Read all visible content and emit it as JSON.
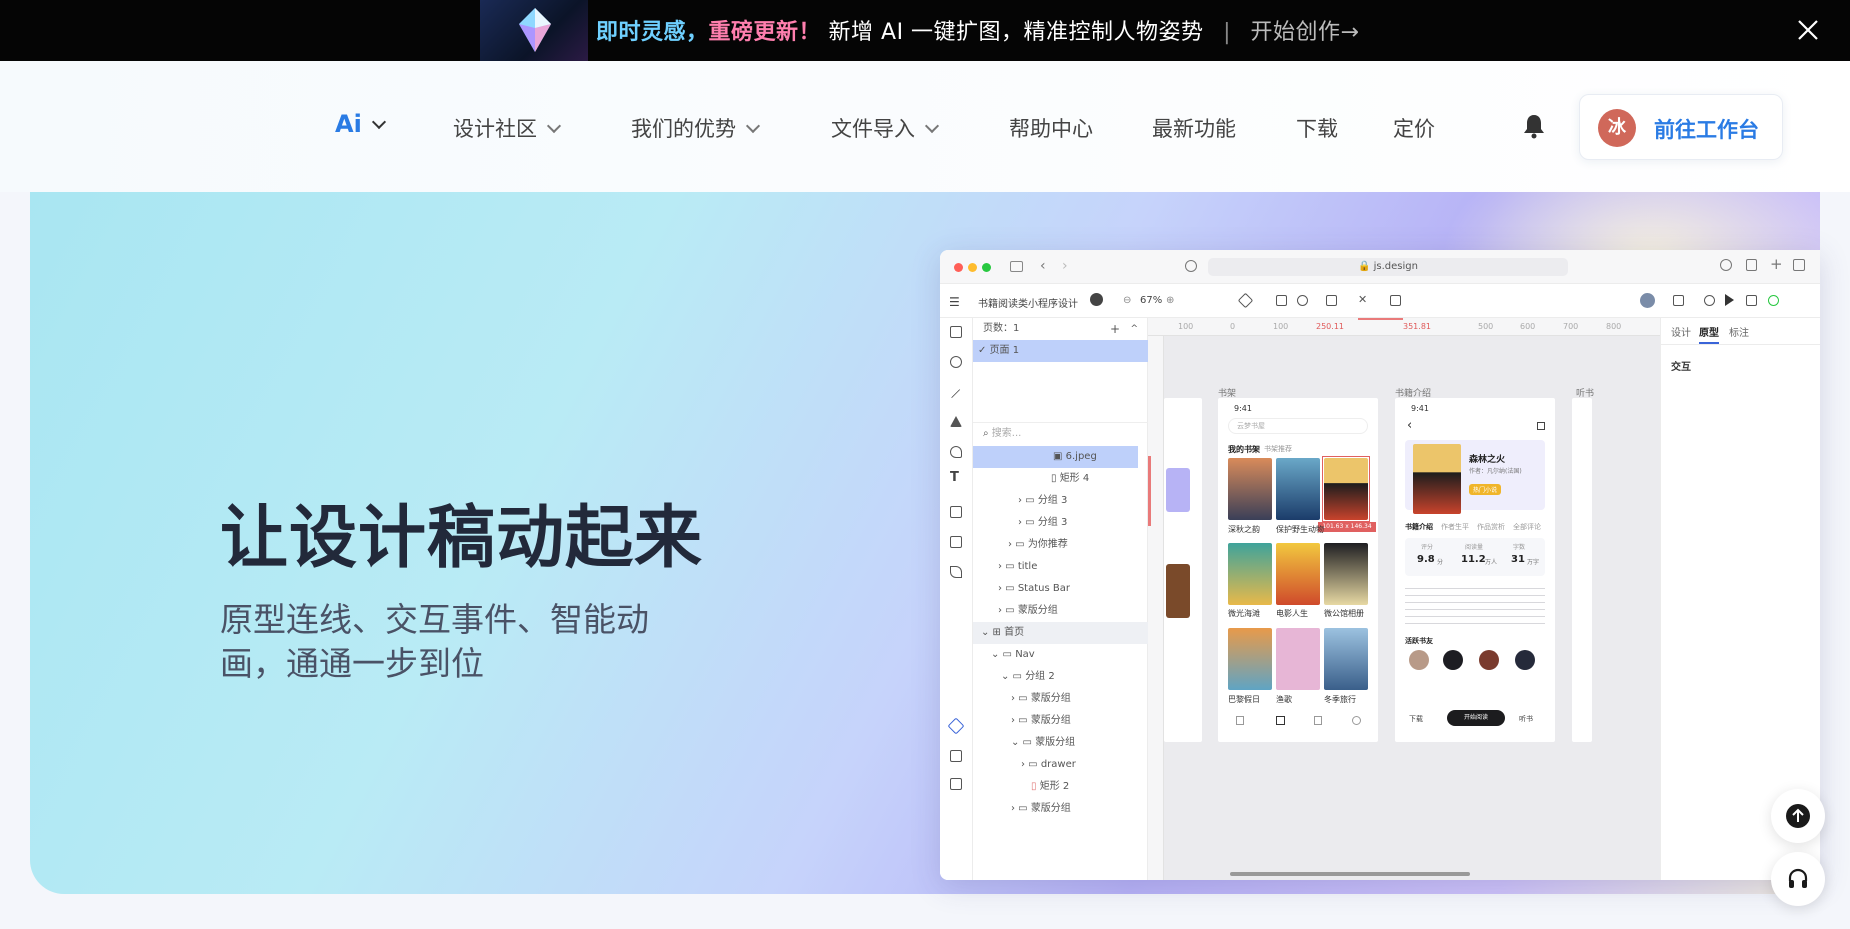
{
  "banner": {
    "part1": "即时灵感，",
    "part2": "重磅更新！",
    "part3": "新增 AI 一键扩图，精准控制人物姿势",
    "separator": "|",
    "cta": "开始创作→"
  },
  "nav": {
    "ai_label": "Ai",
    "items": [
      "设计社区",
      "我们的优势",
      "文件导入",
      "帮助中心",
      "最新功能",
      "下载",
      "定价"
    ],
    "avatar_initial": "冰",
    "workbench_label": "前往工作台"
  },
  "hero": {
    "title": "让设计稿动起来",
    "subtitle": "原型连线、交互事件、智能动画，通通一步到位"
  },
  "app": {
    "url": "js.design",
    "file_name": "书籍阅读类小程序设计",
    "zoom": "67%",
    "pages_label": "页数：1",
    "page1": "页面 1",
    "search_placeholder": "搜索...",
    "layers": [
      "6.jpeg",
      "矩形 4",
      "分组 3",
      "分组 3",
      "为你推荐",
      "title",
      "Status Bar",
      "蒙版分组",
      "首页",
      "Nav",
      "分组 2",
      "蒙版分组",
      "蒙版分组",
      "蒙版分组",
      "drawer",
      "矩形 2",
      "蒙版分组"
    ],
    "ruler": [
      "100",
      "0",
      "100",
      "250.11",
      "351.81",
      "500",
      "600",
      "700",
      "800"
    ],
    "frame_labels": [
      "书架",
      "书籍介绍",
      "听书"
    ],
    "status_time": "9:41",
    "search_hint": "云梦书屋",
    "shelf_tabs": [
      "我的书架",
      "书架推荐"
    ],
    "books": [
      "深秋之韵",
      "保护野生动物",
      "森林之火",
      "微光海滩",
      "电影人生",
      "微公馆相册",
      "巴黎假日",
      "渔歌",
      "冬季旅行"
    ],
    "selection_size": "101.63 x 146.34",
    "detail": {
      "title": "森林之火",
      "author": "作者：凡尔纳(法国)",
      "tag": "热门小说",
      "tabs": [
        "书籍介绍",
        "作者生平",
        "作品赏析",
        "全部评论"
      ],
      "stats": [
        {
          "label": "评分",
          "value": "9.8",
          "unit": "分"
        },
        {
          "label": "阅读量",
          "value": "11.2",
          "unit": "万人"
        },
        {
          "label": "字数",
          "value": "31",
          "unit": "万字"
        }
      ],
      "friends": "活跃书友",
      "bottom": [
        "下载",
        "开始阅读",
        "听书"
      ]
    },
    "right_tabs": [
      "设计",
      "原型",
      "标注"
    ],
    "right_section": "交互"
  },
  "colors": {
    "accent": "#2a7be4",
    "banner_bg": "#050505",
    "hero_title": "#22293a"
  }
}
